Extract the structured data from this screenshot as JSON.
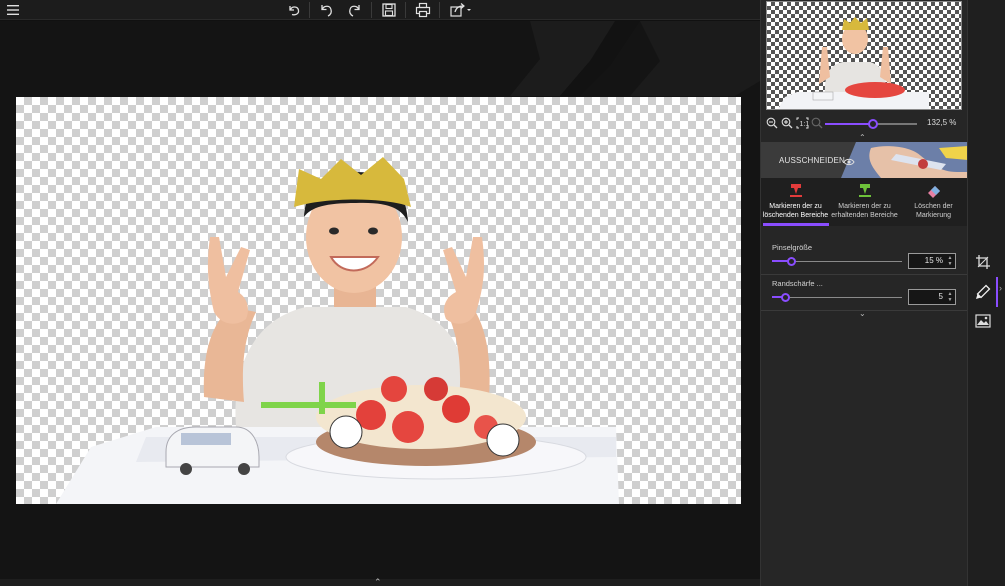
{
  "toolbar": {
    "menu_icon": "hamburger-menu-icon",
    "undo_all_icon": "undo-all-icon",
    "undo_icon": "undo-icon",
    "redo_icon": "redo-icon",
    "save_icon": "save-icon",
    "print_icon": "print-icon",
    "share_icon": "share-icon"
  },
  "navigator": {
    "zoom_value": "132,5 %",
    "zoom_level": 0.52
  },
  "cutout": {
    "label": "AUSSCHNEIDEN"
  },
  "tools": [
    {
      "label_line1": "Markieren der zu",
      "label_line2": "löschenden Bereiche",
      "icon": "red-marker-icon",
      "color": "#e23b3b",
      "active": true
    },
    {
      "label_line1": "Markieren der zu",
      "label_line2": "erhaltenden Bereiche",
      "icon": "green-marker-icon",
      "color": "#6ec23a",
      "active": false
    },
    {
      "label_line1": "Löschen der",
      "label_line2": "Markierung",
      "icon": "eraser-icon",
      "color": "#7fb0e0",
      "active": false
    }
  ],
  "params": {
    "brush_size": {
      "label": "Pinselgröße",
      "value": "15 %",
      "level": 0.15
    },
    "edge_sharpness": {
      "label": "Randschärfe ...",
      "value": "5",
      "level": 0.1
    }
  },
  "strip": {
    "crop_icon": "crop-icon",
    "brush_icon": "brush-icon",
    "image_icon": "image-icon"
  },
  "colors": {
    "accent": "#8a4dff",
    "panel": "#262626",
    "canvas": "#141414"
  }
}
